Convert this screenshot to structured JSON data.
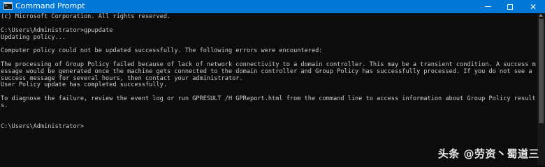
{
  "window": {
    "title": "Command Prompt",
    "titlebar_color": "#0078d7",
    "app_icon": "cmd-icon",
    "controls": {
      "minimize_icon": "minimize-icon",
      "maximize_icon": "maximize-icon",
      "close_icon": "close-icon",
      "close_glyph": "✕"
    }
  },
  "console": {
    "text_color": "#cccccc",
    "background": "#0c0c0c",
    "lines": [
      "(c) Microsoft Corporation. All rights reserved.",
      "",
      "C:\\Users\\Administrator>gpupdate",
      "Updating policy...",
      "",
      "Computer policy could not be updated successfully. The following errors were encountered:",
      "",
      "The processing of Group Policy failed because of lack of network connectivity to a domain controller. This may be a transient condition. A success m",
      "essage would be generated once the machine gets connected to the domain controller and Group Policy has successfully processed. If you do not see a",
      "success message for several hours, then contact your administrator.",
      "User Policy update has completed successfully.",
      "",
      "To diagnose the failure, review the event log or run GPRESULT /H GPReport.html from the command line to access information about Group Policy result",
      "s.",
      "",
      "",
      "C:\\Users\\Administrator>"
    ]
  },
  "watermark": {
    "text": "头条 @劳资丶蜀道三"
  }
}
